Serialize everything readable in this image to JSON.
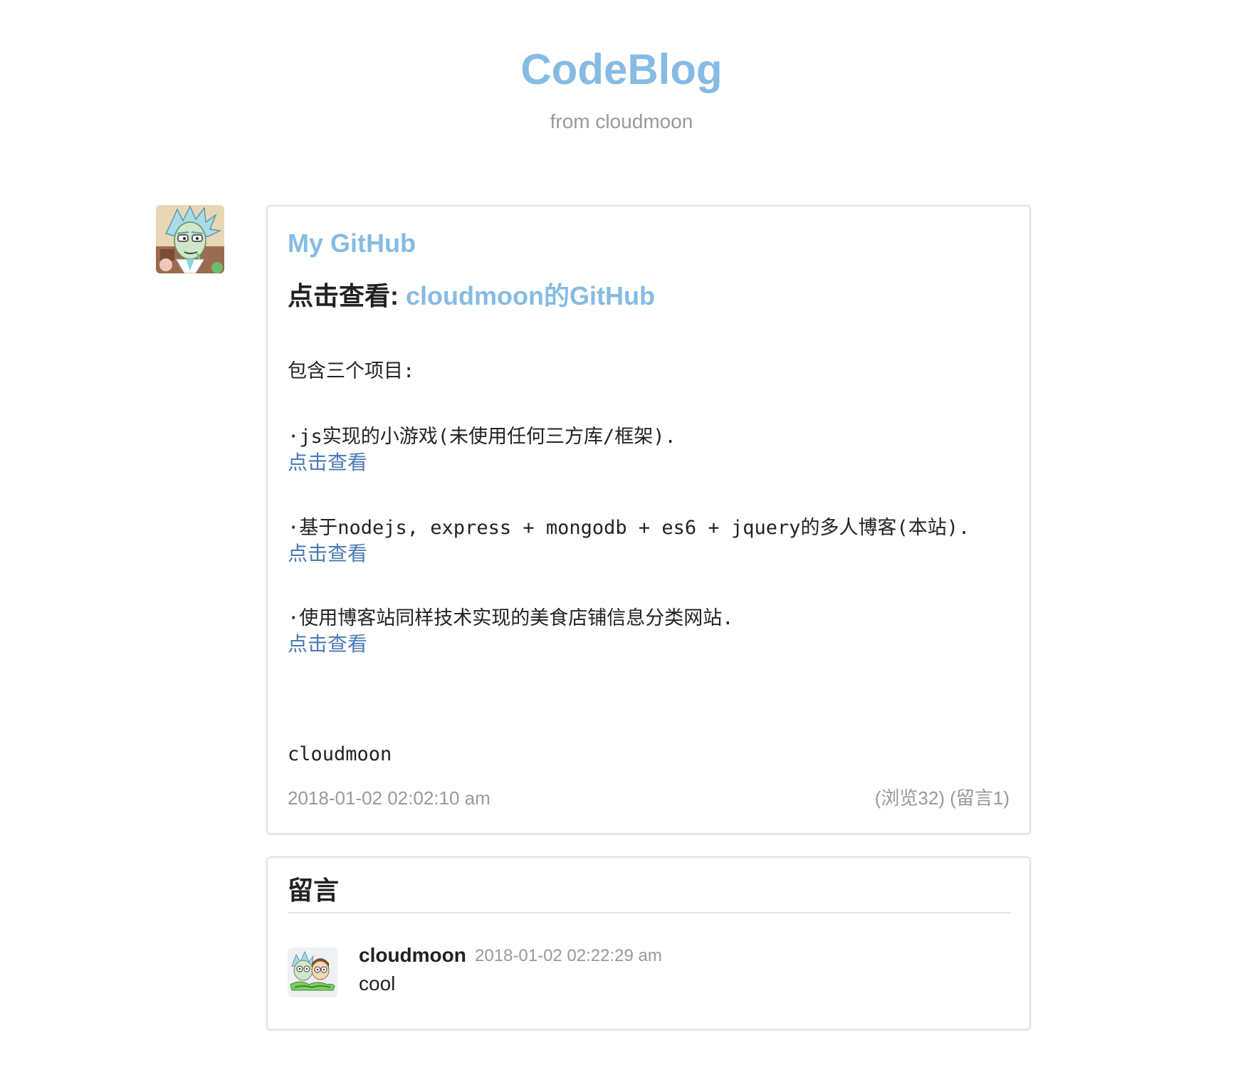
{
  "colors": {
    "accent": "#86bbe3",
    "link": "#4a7ab6",
    "muted": "#999999",
    "text": "#222222",
    "border": "#e3e3e3"
  },
  "header": {
    "title": "CodeBlog",
    "subtitle": "from cloudmoon"
  },
  "post": {
    "author_avatar_icon": "rick-avatar-icon",
    "title": "My GitHub",
    "view_prefix": "点击查看: ",
    "view_link": "cloudmoon的GitHub",
    "intro": "包含三个项目:",
    "projects": [
      {
        "text": "·js实现的小游戏(未使用任何三方库/框架).",
        "link": "点击查看"
      },
      {
        "text": "·基于nodejs, express + mongodb + es6 + jquery的多人博客(本站).",
        "link": "点击查看"
      },
      {
        "text": "·使用博客站同样技术实现的美食店铺信息分类网站.",
        "link": "点击查看"
      }
    ],
    "signature": "cloudmoon",
    "date": "2018-01-02 02:02:10 am",
    "stats": "(浏览32) (留言1)"
  },
  "comments": {
    "heading": "留言",
    "items": [
      {
        "avatar_icon": "rick-and-morty-avatar-icon",
        "author": "cloudmoon",
        "time": "2018-01-02 02:22:29 am",
        "body": "cool"
      }
    ]
  }
}
